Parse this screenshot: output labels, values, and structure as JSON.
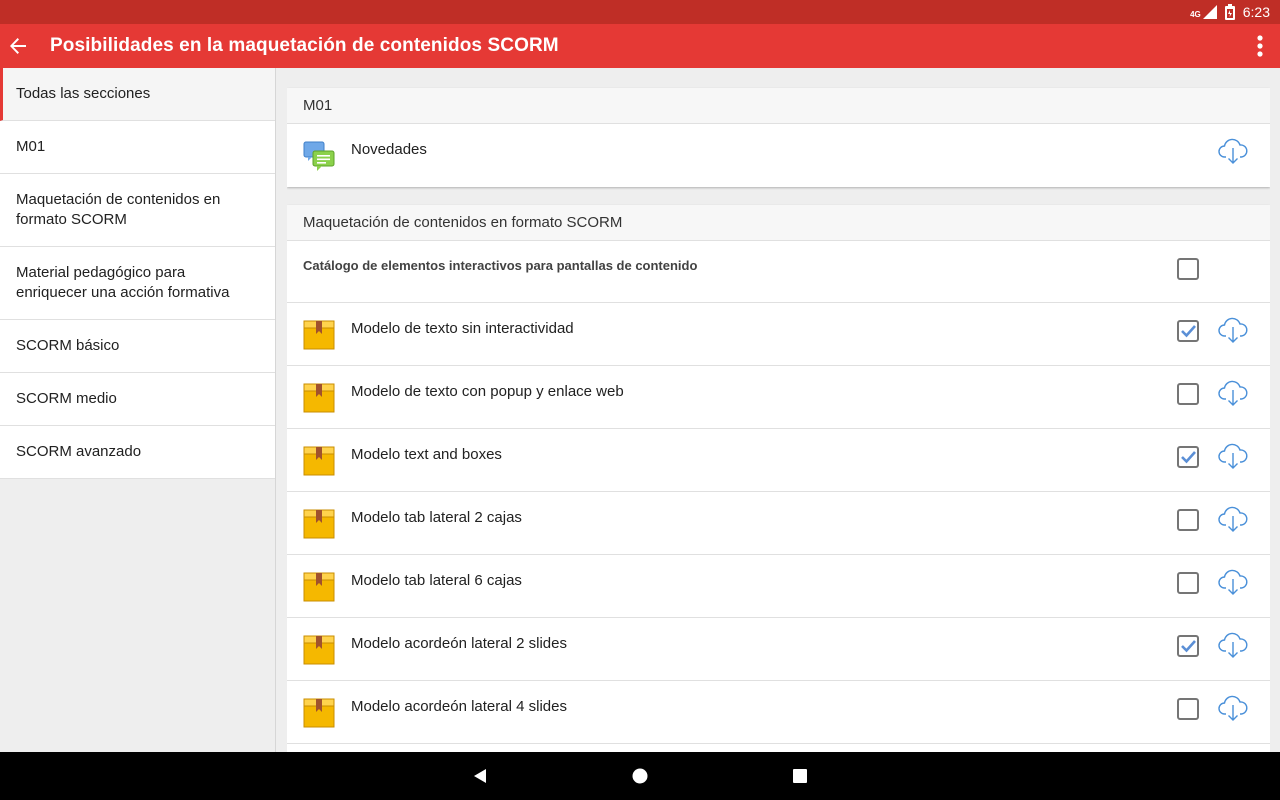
{
  "status": {
    "network": "4G",
    "time": "6:23"
  },
  "app_bar": {
    "title": "Posibilidades en la maquetación de contenidos SCORM"
  },
  "sidebar": {
    "items": [
      {
        "label": "Todas las secciones",
        "active": true
      },
      {
        "label": "M01",
        "active": false
      },
      {
        "label": "Maquetación de contenidos en formato SCORM",
        "active": false
      },
      {
        "label": "Material pedagógico para enriquecer una acción formativa",
        "active": false
      },
      {
        "label": "SCORM básico",
        "active": false
      },
      {
        "label": "SCORM medio",
        "active": false
      },
      {
        "label": "SCORM avanzado",
        "active": false
      }
    ]
  },
  "sections": [
    {
      "title": "M01",
      "items": [
        {
          "label": "Novedades",
          "icon": "forum-icon",
          "checkbox": null,
          "download": true
        }
      ]
    },
    {
      "title": "Maquetación de contenidos en formato SCORM",
      "items": [
        {
          "label": "Catálogo de elementos interactivos para pantallas de contenido",
          "icon": null,
          "bold": true,
          "checkbox": false,
          "download": false
        },
        {
          "label": "Modelo de texto sin interactividad",
          "icon": "package-icon",
          "checkbox": true,
          "download": true
        },
        {
          "label": "Modelo de texto con popup y enlace web",
          "icon": "package-icon",
          "checkbox": false,
          "download": true
        },
        {
          "label": "Modelo text and boxes",
          "icon": "package-icon",
          "checkbox": true,
          "download": true
        },
        {
          "label": "Modelo tab lateral 2 cajas",
          "icon": "package-icon",
          "checkbox": false,
          "download": true
        },
        {
          "label": "Modelo tab lateral 6 cajas",
          "icon": "package-icon",
          "checkbox": false,
          "download": true
        },
        {
          "label": "Modelo acordeón lateral 2 slides",
          "icon": "package-icon",
          "checkbox": true,
          "download": true
        },
        {
          "label": "Modelo acordeón lateral 4 slides",
          "icon": "package-icon",
          "checkbox": false,
          "download": true
        }
      ]
    }
  ],
  "colors": {
    "status_bar": "#bf2e26",
    "app_bar": "#e53935",
    "accent": "#e53935",
    "check_blue": "#5b8fd6",
    "cloud_blue": "#4a90d9"
  }
}
